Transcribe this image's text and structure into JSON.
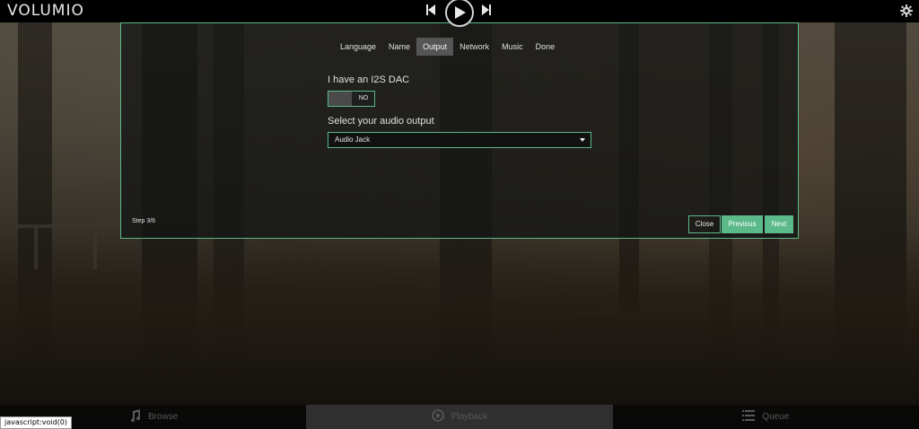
{
  "app": {
    "logo_text": "VOLUMIO"
  },
  "topbar": {
    "prev_icon": "skip-previous-icon",
    "play_icon": "play-icon",
    "next_icon": "skip-next-icon",
    "settings_icon": "gear-icon"
  },
  "wizard": {
    "tabs": [
      {
        "label": "Language",
        "active": false
      },
      {
        "label": "Name",
        "active": false
      },
      {
        "label": "Output",
        "active": true
      },
      {
        "label": "Network",
        "active": false
      },
      {
        "label": "Music",
        "active": false
      },
      {
        "label": "Done",
        "active": false
      }
    ],
    "i2s_dac_label": "I have an I2S DAC",
    "i2s_toggle_value": "NO",
    "audio_output_label": "Select your audio output",
    "audio_output_selected": "Audio Jack",
    "step_text": "Step 3/6",
    "close_label": "Close",
    "previous_label": "Previous",
    "next_label": "Next"
  },
  "bottom_nav": [
    {
      "label": "Browse",
      "icon": "music-note-icon",
      "active": false
    },
    {
      "label": "Playback",
      "icon": "play-circle-icon",
      "active": true
    },
    {
      "label": "Queue",
      "icon": "list-icon",
      "active": false
    }
  ],
  "status_bar": {
    "link_text": "javascript:void(0)"
  },
  "colors": {
    "accent": "#5bb98a",
    "topbar_bg": "#000000",
    "active_tab_bg": "#555555"
  }
}
